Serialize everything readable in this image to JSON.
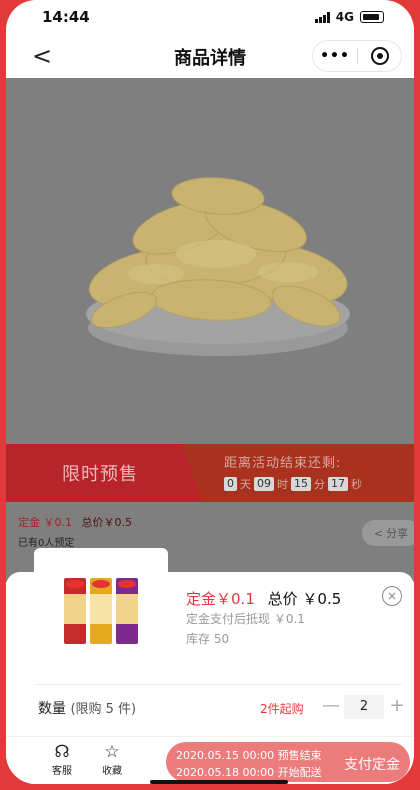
{
  "status": {
    "time": "14:44",
    "network": "4G"
  },
  "nav": {
    "back": "<",
    "title": "商品详情",
    "more": "•••"
  },
  "promo": {
    "label": "限时预售",
    "end_text": "距离活动结束还剩:",
    "countdown": {
      "days": "0",
      "days_unit": "天",
      "hours": "09",
      "hours_unit": "时",
      "minutes": "15",
      "minutes_unit": "分",
      "seconds": "17",
      "seconds_unit": "秒"
    }
  },
  "info": {
    "deposit_label": "定金",
    "deposit_value": "￥0.1",
    "total": "总价￥0.5",
    "booked": "已有0人预定",
    "share": "分享"
  },
  "sheet": {
    "deposit_label": "定金",
    "deposit_value": "￥0.1",
    "total": "总价 ￥0.5",
    "offset": "定金支付后抵现 ￥0.1",
    "stock": "库存 50",
    "close": "×",
    "qty_label": "数量",
    "qty_limit": "(限购 5 件)",
    "min_buy": "2件起购",
    "minus": "—",
    "qty_value": "2",
    "plus": "+"
  },
  "bottom": {
    "service": "客服",
    "favorite": "收藏",
    "presale_end": "2020.05.15 00:00 预售结束",
    "ship_start": "2020.05.18 00:00 开始配送",
    "pay": "支付定金"
  },
  "colors": {
    "accent": "#e23a3a",
    "promo_red": "#b7252a",
    "pay_button": "#ec7b7b"
  }
}
